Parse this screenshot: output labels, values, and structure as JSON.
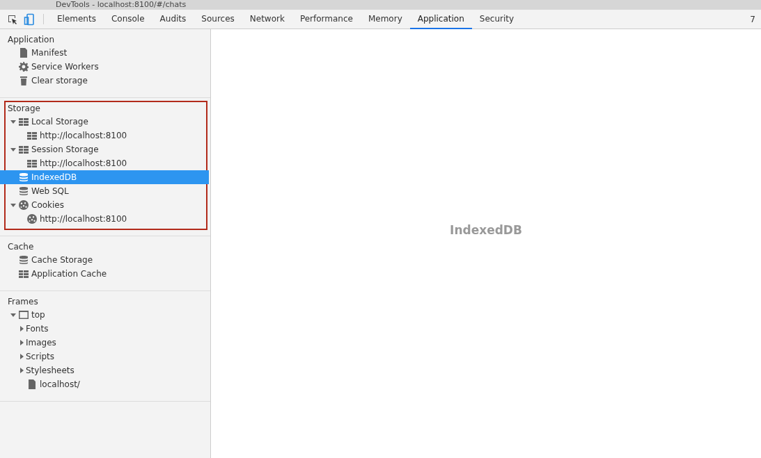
{
  "window": {
    "title": "DevTools - localhost:8100/#/chats"
  },
  "toolbar": {
    "device_mode": {
      "on": true
    },
    "tabs": [
      {
        "label": "Elements",
        "selected": false
      },
      {
        "label": "Console",
        "selected": false
      },
      {
        "label": "Audits",
        "selected": false
      },
      {
        "label": "Sources",
        "selected": false
      },
      {
        "label": "Network",
        "selected": false
      },
      {
        "label": "Performance",
        "selected": false
      },
      {
        "label": "Memory",
        "selected": false
      },
      {
        "label": "Application",
        "selected": true
      },
      {
        "label": "Security",
        "selected": false
      }
    ],
    "counter": "7"
  },
  "sidebar": {
    "sections": [
      {
        "title": "Application",
        "highlighted": false,
        "items": [
          {
            "label": "Manifest",
            "kind": "document",
            "selected": false
          },
          {
            "label": "Service Workers",
            "kind": "gear",
            "selected": false
          },
          {
            "label": "Clear storage",
            "kind": "trash",
            "selected": false
          }
        ]
      },
      {
        "title": "Storage",
        "highlighted": true,
        "items": [
          {
            "label": "Local Storage",
            "kind": "grid",
            "selected": false,
            "expanded": true,
            "children": [
              {
                "label": "http://localhost:8100",
                "kind": "grid",
                "selected": false
              }
            ]
          },
          {
            "label": "Session Storage",
            "kind": "grid",
            "selected": false,
            "expanded": true,
            "children": [
              {
                "label": "http://localhost:8100",
                "kind": "grid",
                "selected": false
              }
            ]
          },
          {
            "label": "IndexedDB",
            "kind": "database",
            "selected": true
          },
          {
            "label": "Web SQL",
            "kind": "database",
            "selected": false
          },
          {
            "label": "Cookies",
            "kind": "cookie",
            "selected": false,
            "expanded": true,
            "children": [
              {
                "label": "http://localhost:8100",
                "kind": "cookie",
                "selected": false
              }
            ]
          }
        ]
      },
      {
        "title": "Cache",
        "highlighted": false,
        "items": [
          {
            "label": "Cache Storage",
            "kind": "database",
            "selected": false
          },
          {
            "label": "Application Cache",
            "kind": "grid",
            "selected": false
          }
        ]
      },
      {
        "title": "Frames",
        "highlighted": false,
        "items": [
          {
            "label": "top",
            "kind": "frame",
            "selected": false,
            "expanded": true,
            "children": [
              {
                "label": "Fonts",
                "kind": "folder",
                "selected": false,
                "expanded": false
              },
              {
                "label": "Images",
                "kind": "folder",
                "selected": false,
                "expanded": false
              },
              {
                "label": "Scripts",
                "kind": "folder",
                "selected": false,
                "expanded": false
              },
              {
                "label": "Stylesheets",
                "kind": "folder",
                "selected": false,
                "expanded": false
              },
              {
                "label": "localhost/",
                "kind": "document",
                "selected": false
              }
            ]
          }
        ]
      }
    ]
  },
  "main": {
    "placeholder_title": "IndexedDB"
  }
}
